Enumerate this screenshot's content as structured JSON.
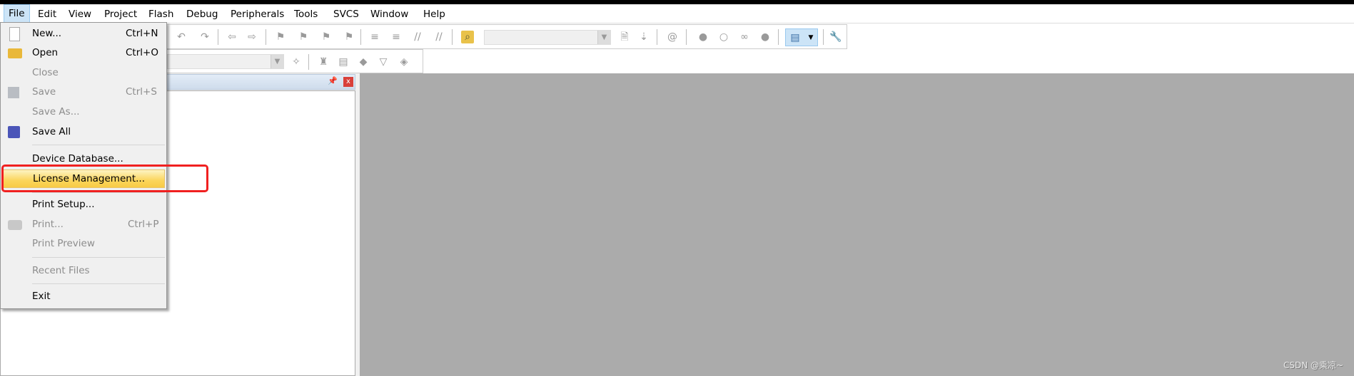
{
  "menubar": {
    "items": [
      "File",
      "Edit",
      "View",
      "Project",
      "Flash",
      "Debug",
      "Peripherals",
      "Tools",
      "SVCS",
      "Window",
      "Help"
    ],
    "active": "File"
  },
  "toolbar": {
    "icons": [
      "undo-icon",
      "redo-icon",
      "back-icon",
      "forward-icon",
      "bookmark-icon",
      "prev-bookmark-icon",
      "next-bookmark-icon",
      "clear-bookmarks-icon",
      "indent-icon",
      "unindent-icon",
      "comment-icon",
      "uncomment-icon",
      "find-in-files-icon",
      "find-icon",
      "incremental-find-icon",
      "debug-session-icon",
      "breakpoint-icon",
      "disable-breakpoint-icon",
      "disable-all-breakpoints-icon",
      "kill-breakpoints-icon",
      "window-layout-icon",
      "configure-icon"
    ]
  },
  "toolbar2": {
    "icons": [
      "target-options-icon",
      "manage-project-icon",
      "select-packs-icon",
      "manage-components-icon",
      "manage-environment-icon",
      "pack-installer-icon"
    ]
  },
  "file_menu": {
    "items": [
      {
        "label": "New...",
        "shortcut": "Ctrl+N",
        "enabled": true,
        "icon": "new-file-icon"
      },
      {
        "label": "Open",
        "shortcut": "Ctrl+O",
        "enabled": true,
        "icon": "open-folder-icon"
      },
      {
        "label": "Close",
        "shortcut": "",
        "enabled": false
      },
      {
        "label": "Save",
        "shortcut": "Ctrl+S",
        "enabled": false,
        "icon": "save-icon"
      },
      {
        "label": "Save As...",
        "shortcut": "",
        "enabled": false
      },
      {
        "label": "Save All",
        "shortcut": "",
        "enabled": true,
        "icon": "save-all-icon"
      },
      {
        "label": "Device Database...",
        "shortcut": "",
        "enabled": true
      },
      {
        "label": "License Management...",
        "shortcut": "",
        "enabled": true,
        "highlighted": true
      },
      {
        "label": "Print Setup...",
        "shortcut": "",
        "enabled": true
      },
      {
        "label": "Print...",
        "shortcut": "Ctrl+P",
        "enabled": false,
        "icon": "print-icon"
      },
      {
        "label": "Print Preview",
        "shortcut": "",
        "enabled": false
      },
      {
        "label": "Recent Files",
        "shortcut": "",
        "enabled": false
      },
      {
        "label": "Exit",
        "shortcut": "",
        "enabled": true
      }
    ]
  },
  "colors": {
    "highlight": "#fbd55b",
    "annotation": "#f02020",
    "workspace": "#ababab"
  },
  "watermark": "CSDN @乘凉~"
}
